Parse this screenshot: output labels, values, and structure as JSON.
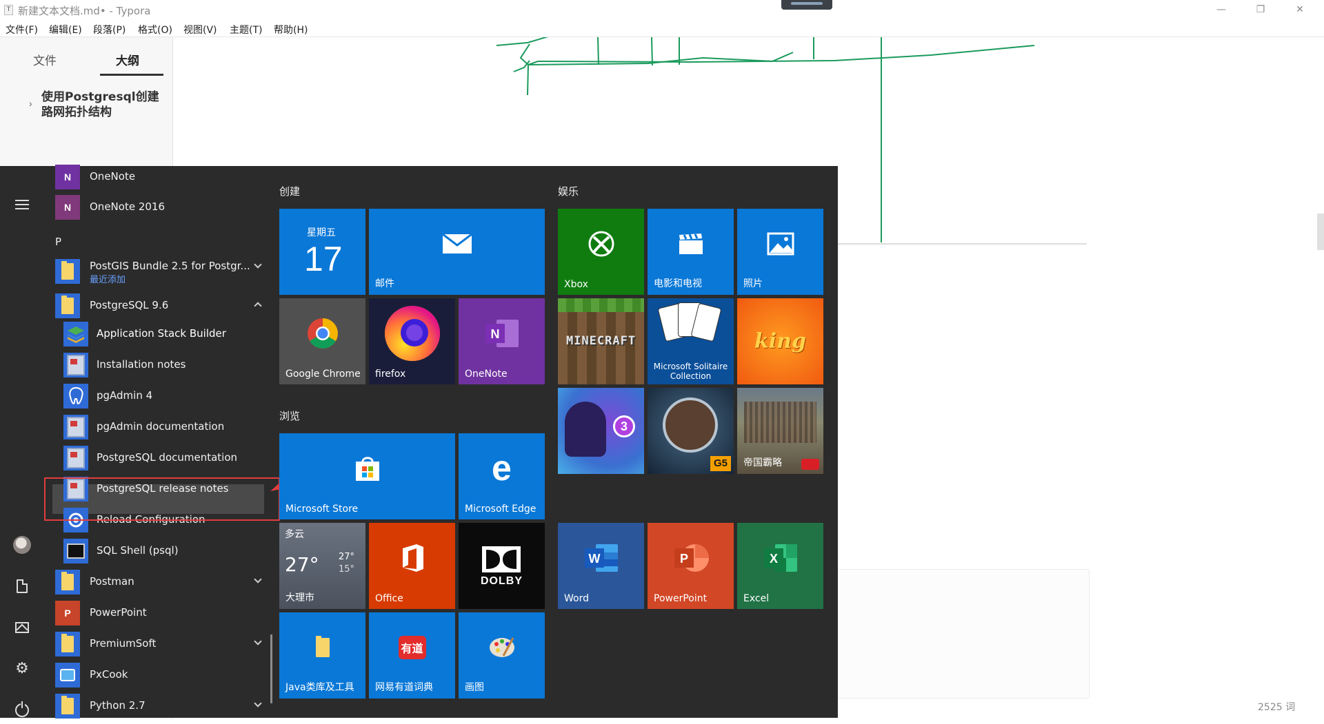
{
  "window": {
    "title_icon": "T",
    "title": "新建文本文档.md• - Typora",
    "minimize": "—",
    "restore": "❐",
    "close": "✕"
  },
  "menubar": [
    "文件(F)",
    "编辑(E)",
    "段落(P)",
    "格式(O)",
    "视图(V)",
    "主题(T)",
    "帮助(H)"
  ],
  "typora_sidebar": {
    "tab_files": "文件",
    "tab_outline": "大纲",
    "outline_item": "使用Postgresql创建路网拓扑结构"
  },
  "status_bar": {
    "word_count": "2525 词"
  },
  "start_menu": {
    "apps": [
      {
        "label": "OneNote",
        "icon": "onenote-icon"
      },
      {
        "label": "OneNote 2016",
        "icon": "onenote-2016-icon"
      },
      {
        "letter": "P"
      },
      {
        "label": "PostGIS Bundle 2.5 for Postgr...",
        "sublabel": "最近添加",
        "icon": "folder-icon",
        "expand": "down"
      },
      {
        "label": "PostgreSQL 9.6",
        "icon": "folder-icon",
        "expand": "up"
      },
      {
        "label": "Application Stack Builder",
        "icon": "stack-builder-icon"
      },
      {
        "label": "Installation notes",
        "icon": "document-icon"
      },
      {
        "label": "pgAdmin 4",
        "icon": "pgadmin-elephant-icon"
      },
      {
        "label": "pgAdmin documentation",
        "icon": "document-icon"
      },
      {
        "label": "PostgreSQL documentation",
        "icon": "document-icon"
      },
      {
        "label": "PostgreSQL release notes",
        "icon": "document-icon"
      },
      {
        "label": "Reload Configuration",
        "icon": "reload-icon"
      },
      {
        "label": "SQL Shell (psql)",
        "icon": "terminal-icon"
      },
      {
        "label": "Postman",
        "icon": "folder-icon",
        "expand": "down"
      },
      {
        "label": "PowerPoint",
        "icon": "powerpoint-icon"
      },
      {
        "label": "PremiumSoft",
        "icon": "folder-icon",
        "expand": "down"
      },
      {
        "label": "PxCook",
        "icon": "pxcook-icon"
      },
      {
        "label": "Python 2.7",
        "icon": "folder-icon",
        "expand": "down"
      }
    ],
    "groups": {
      "create": "创建",
      "browse": "浏览",
      "entertainment": "娱乐"
    },
    "tiles": {
      "calendar": {
        "weekday": "星期五",
        "day": "17"
      },
      "mail": "邮件",
      "chrome": "Google Chrome",
      "firefox": "firefox",
      "onenote": "OneNote",
      "xbox": "Xbox",
      "movies": "电影和电视",
      "photos": "照片",
      "minecraft": "MINECRAFT",
      "solitaire": "Microsoft Solitaire Collection",
      "king": "king",
      "game_badge": "3",
      "g5": "G5",
      "empire": "帝国霸略",
      "store": "Microsoft Store",
      "edge": "Microsoft Edge",
      "weather": {
        "condition": "多云",
        "temp": "27°",
        "high": "27°",
        "low": "15°",
        "city": "大理市"
      },
      "office": "Office",
      "dolby": "DOLBY",
      "word": "Word",
      "powerpoint": "PowerPoint",
      "excel": "Excel",
      "java_tools": "Java类库及工具",
      "youdao": "网易有道词典",
      "youdao_logo": "有道",
      "paint": "画图"
    }
  },
  "colors": {
    "tile_blue": "#0a78d7",
    "xbox_green": "#107c10",
    "onenote_purple": "#7032a0",
    "office_orange": "#d83b01",
    "word_blue": "#2b579a",
    "powerpoint_red": "#d24726",
    "excel_green": "#217346",
    "highlight_red": "#e33d3d",
    "menu_bg": "#2b2b2b"
  }
}
